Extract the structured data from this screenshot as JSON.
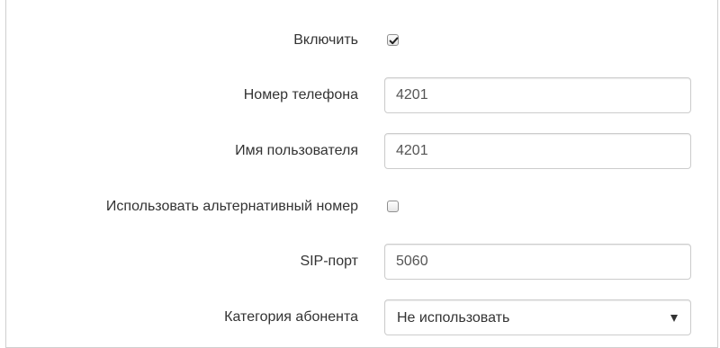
{
  "form": {
    "enable": {
      "label": "Включить",
      "checked": true
    },
    "phone_number": {
      "label": "Номер телефона",
      "value": "4201"
    },
    "username": {
      "label": "Имя пользователя",
      "value": "4201"
    },
    "alt_number": {
      "label": "Использовать альтернативный номер",
      "checked": false
    },
    "sip_port": {
      "label": "SIP-порт",
      "value": "5060"
    },
    "subscriber_category": {
      "label": "Категория абонента",
      "selected": "Не использовать"
    }
  },
  "colors": {
    "label_text": "#333333",
    "input_border": "#cccccc",
    "frame_border": "#cfcfcf"
  },
  "icons": {
    "checkmark": "checkmark-icon",
    "dropdown": "caret-down-icon"
  }
}
